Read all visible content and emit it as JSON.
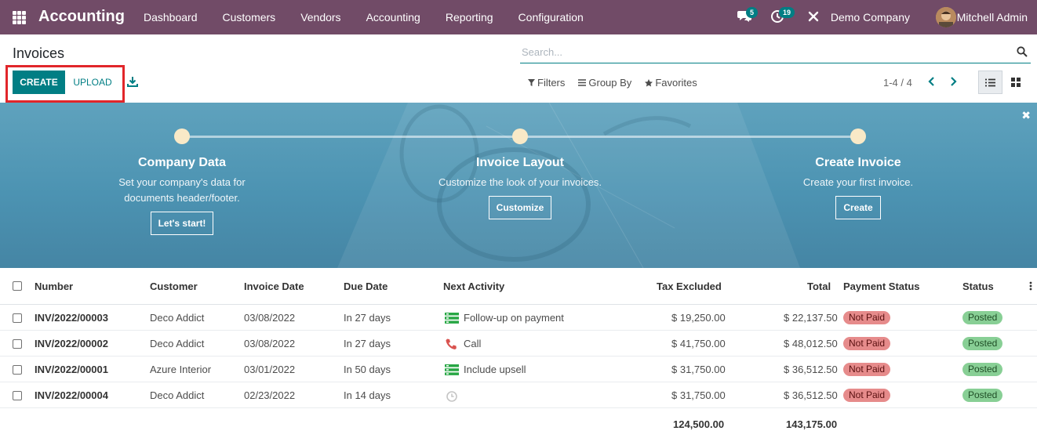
{
  "navbar": {
    "app_name": "Accounting",
    "menu": [
      "Dashboard",
      "Customers",
      "Vendors",
      "Accounting",
      "Reporting",
      "Configuration"
    ],
    "messages_count": "5",
    "activities_count": "19",
    "company": "Demo Company",
    "user": "Mitchell Admin"
  },
  "control": {
    "title": "Invoices",
    "search_placeholder": "Search...",
    "create_label": "CREATE",
    "upload_label": "UPLOAD",
    "filters_label": "Filters",
    "groupby_label": "Group By",
    "favorites_label": "Favorites",
    "pager": "1-4 / 4"
  },
  "banner": {
    "steps": [
      {
        "title": "Company Data",
        "desc1": "Set your company's data for",
        "desc2": "documents header/footer.",
        "button": "Let's start!"
      },
      {
        "title": "Invoice Layout",
        "desc1": "Customize the look of your invoices.",
        "desc2": "",
        "button": "Customize"
      },
      {
        "title": "Create Invoice",
        "desc1": "Create your first invoice.",
        "desc2": "",
        "button": "Create"
      }
    ]
  },
  "table": {
    "headers": {
      "number": "Number",
      "customer": "Customer",
      "invoice_date": "Invoice Date",
      "due_date": "Due Date",
      "next_activity": "Next Activity",
      "tax_excluded": "Tax Excluded",
      "total": "Total",
      "payment_status": "Payment Status",
      "status": "Status"
    },
    "rows": [
      {
        "number": "INV/2022/00003",
        "customer": "Deco Addict",
        "invoice_date": "03/08/2022",
        "due_date": "In 27 days",
        "activity": "Follow-up on payment",
        "activity_icon": "task-list-icon",
        "tax_excluded": "$ 19,250.00",
        "total": "$ 22,137.50",
        "payment_status": "Not Paid",
        "status": "Posted"
      },
      {
        "number": "INV/2022/00002",
        "customer": "Deco Addict",
        "invoice_date": "03/08/2022",
        "due_date": "In 27 days",
        "activity": "Call",
        "activity_icon": "phone-icon",
        "tax_excluded": "$ 41,750.00",
        "total": "$ 48,012.50",
        "payment_status": "Not Paid",
        "status": "Posted"
      },
      {
        "number": "INV/2022/00001",
        "customer": "Azure Interior",
        "invoice_date": "03/01/2022",
        "due_date": "In 50 days",
        "activity": "Include upsell",
        "activity_icon": "task-list-icon",
        "tax_excluded": "$ 31,750.00",
        "total": "$ 36,512.50",
        "payment_status": "Not Paid",
        "status": "Posted"
      },
      {
        "number": "INV/2022/00004",
        "customer": "Deco Addict",
        "invoice_date": "02/23/2022",
        "due_date": "In 14 days",
        "activity": "",
        "activity_icon": "clock-icon",
        "tax_excluded": "$ 31,750.00",
        "total": "$ 36,512.50",
        "payment_status": "Not Paid",
        "status": "Posted"
      }
    ],
    "totals": {
      "tax_excluded": "124,500.00",
      "total": "143,175.00"
    }
  },
  "colors": {
    "navbar": "#714b67",
    "primary": "#017e84",
    "highlight": "#e1262a",
    "not_paid": "#e68b8b",
    "posted": "#88cf95"
  }
}
